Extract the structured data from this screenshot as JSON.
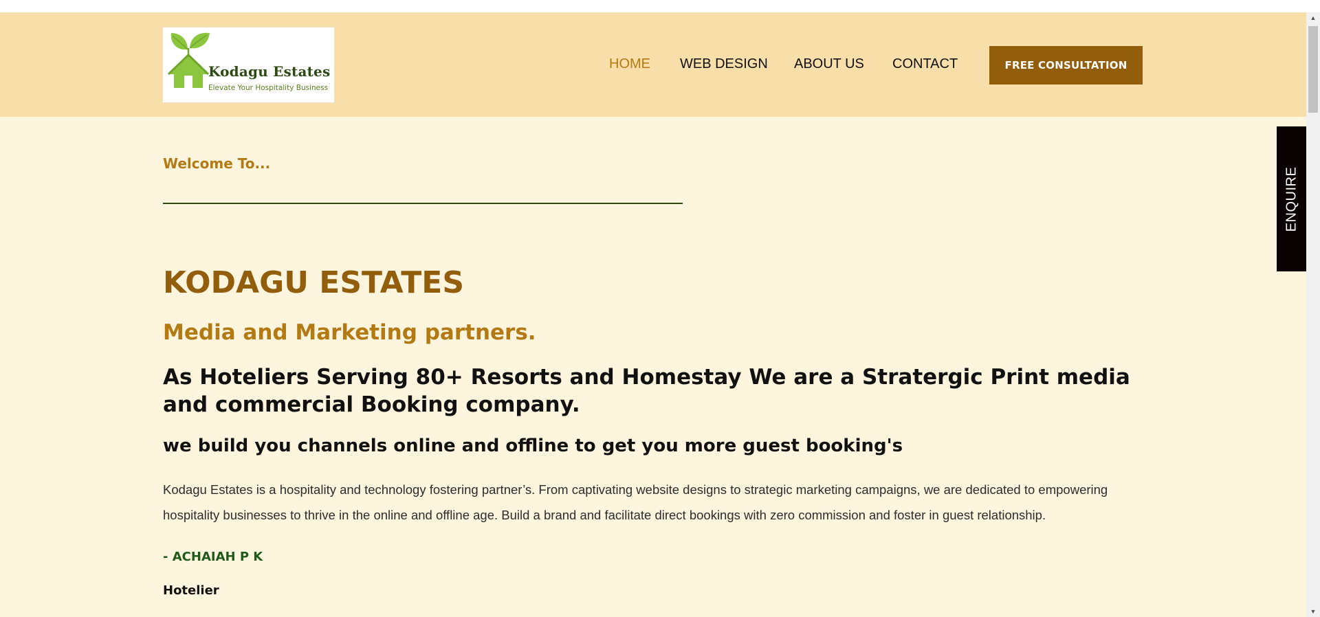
{
  "logo": {
    "title": "Kodagu  Estates",
    "tagline": "Elevate Your Hospitality Business"
  },
  "nav": {
    "items": [
      {
        "label": "HOME",
        "active": true
      },
      {
        "label": "WEB DESIGN",
        "active": false
      },
      {
        "label": "ABOUT US",
        "active": false
      },
      {
        "label": "CONTACT",
        "active": false
      }
    ],
    "cta_label": "FREE CONSULTATION"
  },
  "hero": {
    "welcome": "Welcome To...",
    "company": "KODAGU ESTATES",
    "tagline": "Media and Marketing partners.",
    "serving": "As Hoteliers Serving 80+ Resorts and Homestay We are a Stratergic Print media and commercial Booking company.",
    "build": "we build you channels online and offline to get you more guest booking's",
    "paragraph": "Kodagu Estates is a hospitality and technology fostering partner’s. From captivating website designs to strategic marketing campaigns, we are dedicated to empowering hospitality businesses to thrive in the online and offline age. Build a brand and facilitate direct bookings with zero commission and foster in guest relationship.",
    "author": "- ACHAIAH P K",
    "role": "Hotelier"
  },
  "side_tab": {
    "label": "ENQUIRE"
  },
  "colors": {
    "header_bg": "#f8dea9",
    "page_bg": "#fef5df",
    "accent_brown": "#935e0c",
    "accent_gold": "#b37a14",
    "author_green": "#1f5a1a"
  },
  "icons": {
    "logo_mark": "house-with-leaves-icon",
    "scroll_up": "scroll-up-arrow-icon",
    "scroll_down": "scroll-down-arrow-icon"
  }
}
